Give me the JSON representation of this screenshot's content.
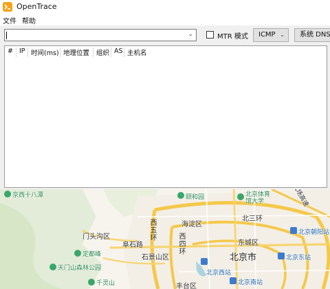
{
  "window": {
    "title": "OpenTrace"
  },
  "menu": {
    "file": "文件",
    "help": "帮助"
  },
  "toolbar": {
    "target_value": "",
    "mtr_label": "MTR 模式",
    "protocol": "ICMP",
    "dns_label": "系统 DNS"
  },
  "table": {
    "columns": [
      "#",
      "IP",
      "时间(ms)",
      "地理位置",
      "组织",
      "AS",
      "主机名"
    ]
  },
  "map": {
    "labels": {
      "jingxi": "京西十八潭",
      "yiheyuan": "颐和园",
      "beijing_tiyu": "北京体育",
      "beijing_tiyu2": "馆大学",
      "haidian": "海淀区",
      "beisanhuan": "北三环",
      "mentougou": "门头沟区",
      "dingdufeng": "定都峰",
      "fuhua": "阜石路",
      "shijingshan": "石景山区",
      "xisihuan_a": "西五环",
      "xisihuan_b": "西四环",
      "dongcheng": "东城区",
      "beijing_city": "北京市",
      "chaoyang": "北京朝阳站",
      "tianmen": "天门山森林公园",
      "beijingxi": "北京西站",
      "beijingdong": "北京东站",
      "qianlingshan": "千灵山",
      "fengtai": "丰台区",
      "beijingnan": "北京南站",
      "jichang": "机场高速"
    }
  }
}
